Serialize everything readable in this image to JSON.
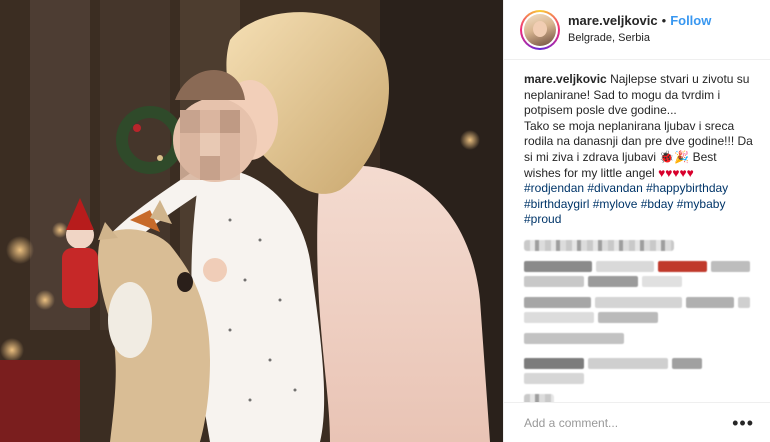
{
  "header": {
    "username": "mare.veljkovic",
    "separator": "•",
    "follow_label": "Follow",
    "location": "Belgrade, Serbia"
  },
  "caption": {
    "username": "mare.veljkovic",
    "text_1": "Najlepse stvari u zivotu su neplanirane! Sad to mogu da tvrdim i potpisem posle dve godine...",
    "text_2": "Tako se moja neplanirana ljubav i sreca rodila na danasnji dan pre dve godine!!! Da si mi ziva i zdrava ljubavi",
    "emoji": "🐞🎉",
    "text_3": "Best wishes for my little angel",
    "hearts": "♥♥♥♥♥",
    "hashtags": "#rodjendan #divandan #happybirthday #birthdaygirl #mylove #bday #mybaby #proud"
  },
  "footer": {
    "add_comment_placeholder": "Add a comment...",
    "more_icon": "•••"
  },
  "colors": {
    "link_blue": "#3897f0",
    "hashtag_blue": "#003569",
    "heart_red": "#d8002c",
    "border": "#efefef"
  },
  "icons": [
    "avatar",
    "more-options-icon"
  ]
}
